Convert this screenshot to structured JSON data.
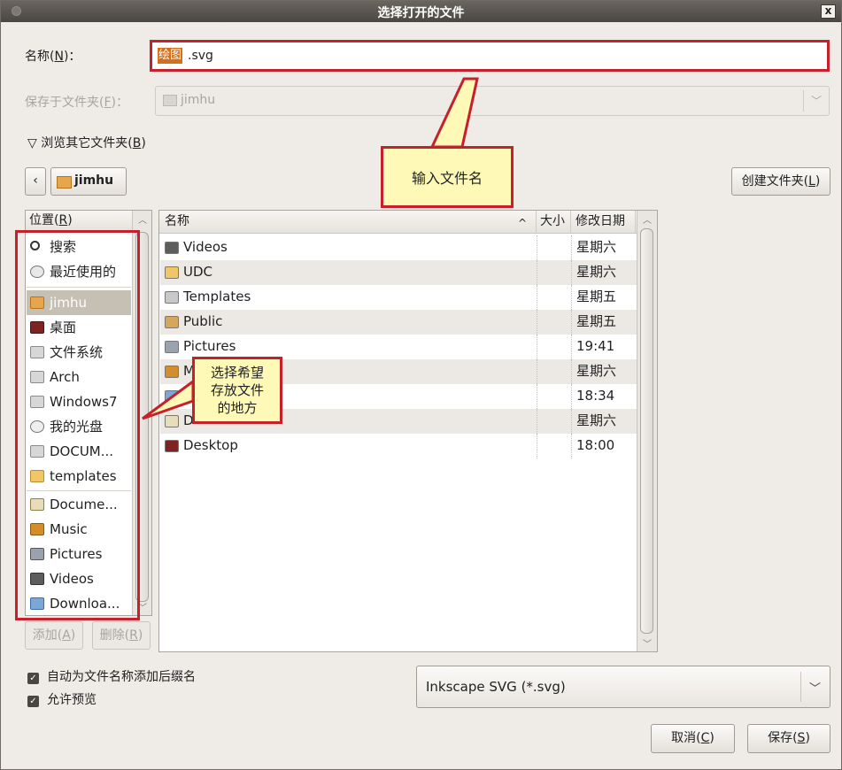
{
  "window": {
    "title": "选择打开的文件",
    "close_label": "x"
  },
  "name_row": {
    "label_prefix": "名称(",
    "label_key": "N",
    "label_suffix": ")：",
    "value_selected": "绘图",
    "value_rest": ".svg"
  },
  "save_in_row": {
    "label_prefix": "保存于文件夹(",
    "label_key": "F",
    "label_suffix": ")：",
    "value": "jimhu"
  },
  "browse_toggle": {
    "arrow": "▽",
    "label_prefix": "浏览其它文件夹(",
    "label_key": "B",
    "label_suffix": ")"
  },
  "breadcrumb": {
    "back": "‹",
    "current": "jimhu"
  },
  "create_folder": {
    "label_prefix": "创建文件夹(",
    "label_key": "L",
    "label_suffix": ")"
  },
  "places": {
    "header_prefix": "位置(",
    "header_key": "R",
    "header_suffix": ")",
    "items": [
      {
        "label": "搜索",
        "icon": "search-icon"
      },
      {
        "label": "最近使用的",
        "icon": "recent-icon"
      },
      {
        "label": "jimhu",
        "icon": "home-folder-icon",
        "selected": true
      },
      {
        "label": "桌面",
        "icon": "desktop-icon"
      },
      {
        "label": "文件系统",
        "icon": "drive-icon"
      },
      {
        "label": "Arch",
        "icon": "drive-icon"
      },
      {
        "label": "Windows7",
        "icon": "drive-icon"
      },
      {
        "label": "我的光盘",
        "icon": "disc-icon"
      },
      {
        "label": "DOCUM...",
        "icon": "drive-icon"
      },
      {
        "label": "templates",
        "icon": "folder-icon"
      },
      {
        "label": "Docume...",
        "icon": "documents-folder-icon"
      },
      {
        "label": "Music",
        "icon": "music-folder-icon"
      },
      {
        "label": "Pictures",
        "icon": "pictures-folder-icon"
      },
      {
        "label": "Videos",
        "icon": "videos-folder-icon"
      },
      {
        "label": "Downloa...",
        "icon": "downloads-folder-icon"
      }
    ],
    "add_prefix": "添加(",
    "add_key": "A",
    "add_suffix": ")",
    "remove_prefix": "删除(",
    "remove_key": "R",
    "remove_suffix": ")"
  },
  "file_list": {
    "columns": {
      "name": "名称",
      "sort_arrow": "^",
      "size": "大小",
      "modified": "修改日期"
    },
    "rows": [
      {
        "name": "Videos",
        "modified": "星期六",
        "icon": "videos-folder-icon"
      },
      {
        "name": "UDC",
        "modified": "星期六",
        "icon": "folder-icon"
      },
      {
        "name": "Templates",
        "modified": "星期五",
        "icon": "templates-folder-icon"
      },
      {
        "name": "Public",
        "modified": "星期五",
        "icon": "public-folder-icon"
      },
      {
        "name": "Pictures",
        "modified": "19:41",
        "icon": "pictures-folder-icon"
      },
      {
        "name": "M",
        "modified": "星期六",
        "icon": "music-folder-icon"
      },
      {
        "name": "D",
        "modified": "18:34",
        "icon": "downloads-folder-icon"
      },
      {
        "name": "D",
        "modified": "星期六",
        "icon": "documents-folder-icon"
      },
      {
        "name": "Desktop",
        "modified": "18:00",
        "icon": "desktop-icon"
      }
    ]
  },
  "callouts": {
    "filename": "输入文件名",
    "location_line1": "选择希望",
    "location_line2": "存放文件",
    "location_line3": "的地方"
  },
  "options": {
    "auto_ext_label": "自动为文件名称添加后缀名",
    "auto_ext_checked": true,
    "preview_label": "允许预览",
    "preview_checked": true
  },
  "filter": {
    "value": "Inkscape SVG (*.svg)"
  },
  "actions": {
    "cancel_prefix": "取消(",
    "cancel_key": "C",
    "cancel_suffix": ")",
    "save_prefix": "保存(",
    "save_key": "S",
    "save_suffix": ")"
  },
  "colors": {
    "annotation_red": "#c6212a",
    "callout_fill": "#fff9b8",
    "selection": "#c6bfb4",
    "text_selection": "#d1701d"
  }
}
